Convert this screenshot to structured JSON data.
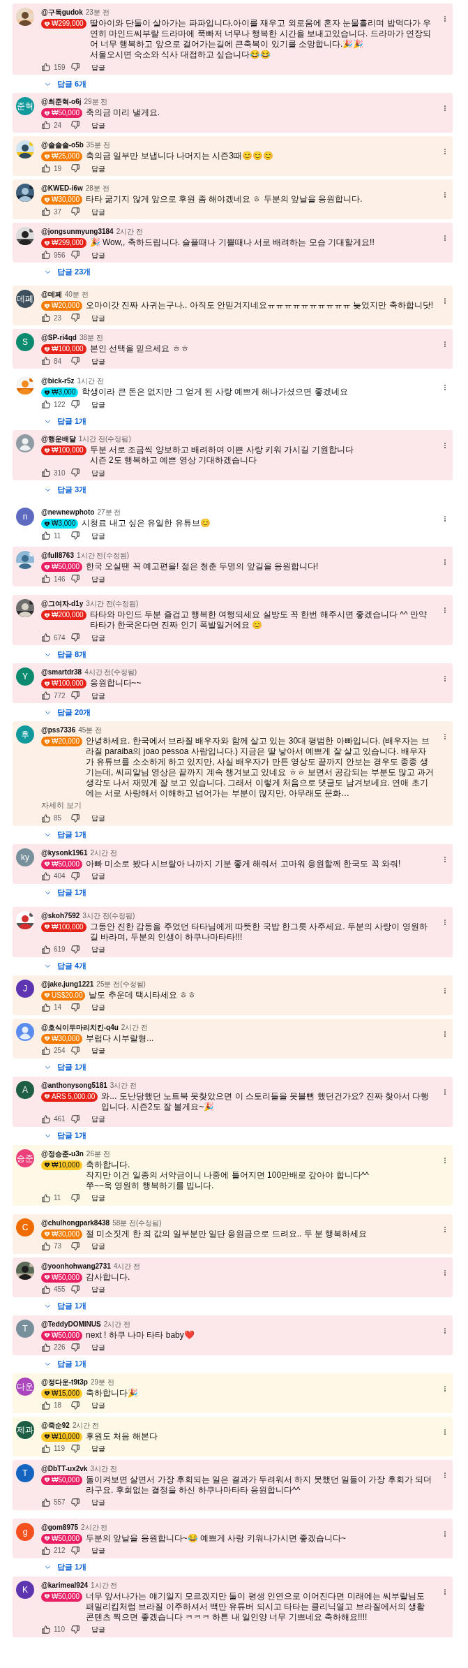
{
  "groups": [
    {
      "comments": [
        {
          "user": "@구독gudok",
          "time": "23분 전",
          "badge": {
            "amount": "₩299,000",
            "color": "#e62117"
          },
          "text": "딸아이와 단둘이 살아가는 파파입니다.아이를 재우고 외로움에 혼자 눈물흘리며 밥먹다가 우연히 마인드씨부랄 드라마에 푹빠저 너무나 행복한 시간을 보내고있습니다. 드라마가 연장되어 너무 행복하고 앞으로 걸어가는길에 큰축복이 있기를 소망합니다.🎉🎉\n서울오시면 숙소와 식사 대접하고 싶습니다😂😂",
          "likes": "159",
          "reply": "답글",
          "replies": "답글 6개"
        },
        {
          "user": "@최준혁-o6j",
          "time": "29분 전",
          "avatar": {
            "kind": "letter",
            "letter": "준혁",
            "color": "#12999b"
          },
          "badge": {
            "amount": "₩50,000",
            "color": "#e91e63"
          },
          "text": "축의금 미리 낼게요.",
          "likes": "24",
          "reply": "답글"
        },
        {
          "user": "@솔솔솔-o5b",
          "time": "35분 전",
          "badge": {
            "amount": "₩25,000",
            "color": "#f57c00"
          },
          "text": "축의금 일부만 보냅니다 나머지는 시즌3때😊😊😊",
          "likes": "19",
          "reply": "답글"
        },
        {
          "user": "@KWED-i6w",
          "time": "28분 전",
          "badge": {
            "amount": "₩30,000",
            "color": "#f57c00"
          },
          "text": "타타 굶기지 않게 앞으로 후원 좀 해야겠네요 ㅎ 두분의 앞날을 응원합니다.",
          "likes": "37",
          "reply": "답글"
        },
        {
          "user": "@jongsunmyung3184",
          "time": "2시간 전",
          "badge": {
            "amount": "₩299,000",
            "color": "#e62117"
          },
          "text": "🎉 Wow,, 축하드립니다. 슬플때나 기쁠때나 서로 배려하는 모습 기대할게요!!",
          "likes": "956",
          "reply": "답글",
          "replies": "답글 23개"
        }
      ]
    },
    {
      "comments": [
        {
          "user": "@데페",
          "time": "40분 전",
          "avatar": {
            "kind": "letter",
            "letter": "데페",
            "color": "#3d4f5c"
          },
          "badge": {
            "amount": "₩20,000",
            "color": "#f57c00"
          },
          "text": "오마이갓 진짜 사귀는구나.. 아직도 안믿겨지네요ㅠㅠㅠㅠㅠㅠㅠㅠㅠㅠ 늦었지만 축하합니닷!",
          "likes": "23",
          "reply": "답글"
        },
        {
          "user": "@SP-ri4qd",
          "time": "38분 전",
          "avatar": {
            "kind": "letter",
            "letter": "S",
            "color": "#0b8a6f"
          },
          "badge": {
            "amount": "₩100,000",
            "color": "#e62117"
          },
          "text": "본인 선택을 믿으세요 ㅎㅎ",
          "likes": "84",
          "reply": "답글"
        },
        {
          "user": "@bick-r5z",
          "time": "1시간 전",
          "badge": {
            "amount": "₩3,000",
            "color": "#00e5ff"
          },
          "text": "학생이라 큰 돈은 없지만 그 얻게 된 사랑 예쁘게 해나가셨으면 좋겠네요",
          "likes": "122",
          "reply": "답글",
          "replies": "답글 1개"
        },
        {
          "user": "@행운배달",
          "time": "1시간 전(수정됨)",
          "avatar": {
            "kind": "default",
            "color": "#8f9ba3"
          },
          "badge": {
            "amount": "₩100,000",
            "color": "#e62117"
          },
          "text": "두분 서로 조금씩 양보하고 배려하여 이쁜 사랑 키워 가시길 기원합니다\n시즌 2도 행복하고 예쁜 영상 기대하겠습니다",
          "likes": "310",
          "reply": "답글",
          "replies": "답글 3개"
        }
      ]
    },
    {
      "comments": [
        {
          "user": "@newnewphoto",
          "time": "27분 전",
          "avatar": {
            "kind": "letter",
            "letter": "n",
            "color": "#5c6bc0"
          },
          "badge": {
            "amount": "₩3,000",
            "color": "#00e5ff"
          },
          "text": "시청료 내고 싶은 유일한 유튜브😊",
          "likes": "11",
          "reply": "답글"
        },
        {
          "user": "@full8763",
          "time": "1시간 전(수정됨)",
          "badge": {
            "amount": "₩50,000",
            "color": "#e91e63"
          },
          "text": "한국 오실땐 꼭 예고편을! 젊은 청춘 두명의 앞길을 응원합니다!",
          "likes": "146",
          "reply": "답글"
        }
      ]
    },
    {
      "comments": [
        {
          "user": "@그여자-d1y",
          "time": "3시간 전(수정됨)",
          "badge": {
            "amount": "₩200,000",
            "color": "#e62117"
          },
          "text": "타타와  마인드 두분 즐겁고 행복한 여행되세요   실방도 꼭 한번 해주시면 좋겠습니다 ^^  만약 타타가 한국온다면 진짜 인기 폭발일거에요 😊",
          "likes": "674",
          "reply": "답글",
          "replies": "답글 8개"
        },
        {
          "user": "@smartdr38",
          "time": "4시간 전(수정됨)",
          "avatar": {
            "kind": "letter",
            "letter": "Y",
            "color": "#0b8a6f"
          },
          "badge": {
            "amount": "₩100,000",
            "color": "#e62117"
          },
          "text": "응원합니다~~",
          "likes": "772",
          "reply": "답글",
          "replies": "답글 20개"
        },
        {
          "user": "@pss7336",
          "time": "45분 전",
          "avatar": {
            "kind": "letter",
            "letter": "후",
            "color": "#12999b"
          },
          "badge": {
            "amount": "₩20,000",
            "color": "#f57c00"
          },
          "text": "안녕하세요. 한국에서 브라질 배우자와 함께 살고 있는 30대 평범한 아빠입니다. (배우자는 브라질 paraiba의 joao pessoa 사람입니다.) 지금은 딸 낳아서 예쁘게 잘 살고 있습니다. 배우자가 유튜브를 소소하게 하고 있지만, 사실 배우자가 만든 영상도 끝까지 안보는 경우도 종종 생기는데, 씨피알님 영상은 끝까지 계속 챙겨보고 있네요 ㅎㅎ 보면서 공감되는 부분도 많고 과거생각도 나서 재밌게 잘 보고 있습니다. 그래서 이렇게 처음으로 댓글도 남겨보네요. 연애 초기에는 서로 사랑해서 이해하고 넘어가는 부분이 많지만, 아무래도 문화…",
          "more": "자세히 보기",
          "likes": "85",
          "reply": "답글",
          "replies": "답글 1개"
        },
        {
          "user": "@kysonk1961",
          "time": "2시간 전",
          "avatar": {
            "kind": "letter",
            "letter": "ky",
            "color": "#78909c"
          },
          "badge": {
            "amount": "₩50,000",
            "color": "#e91e63"
          },
          "text": "아빠 미소로 봤다 시브랄아 나까지 기분 좋게 해줘서 고마워 응원할께 한국도 꼭 와줘!",
          "likes": "404",
          "reply": "답글",
          "replies": "답글 1개"
        }
      ]
    },
    {
      "comments": [
        {
          "user": "@skoh7592",
          "time": "3시간 전(수정됨)",
          "badge": {
            "amount": "₩100,000",
            "color": "#e62117"
          },
          "text": "그동안 진한 감동을 주었던 타타님에게 따뜻한 국밥 한그릇 사주세요. 두분의 사랑이 영원하길 바라며, 두분의 인생이 하쿠나마타타!!!",
          "likes": "619",
          "reply": "답글",
          "replies": "답글 4개"
        },
        {
          "user": "@jake.jung1221",
          "time": "25분 전(수정됨)",
          "avatar": {
            "kind": "letter",
            "letter": "J",
            "color": "#5e35b1"
          },
          "badge": {
            "amount": "US$20.00",
            "color": "#f57c00"
          },
          "text": "날도 추운데 택시타세요 ㅎㅎ",
          "likes": "14",
          "reply": "답글"
        },
        {
          "user": "@호식이두마리치킨-q4u",
          "time": "2시간 전",
          "avatar": {
            "kind": "default",
            "color": "#5b8def"
          },
          "badge": {
            "amount": "₩30,000",
            "color": "#f57c00"
          },
          "text": "부럽다 시부랄형...",
          "likes": "254",
          "reply": "답글",
          "replies": "답글 1개"
        },
        {
          "user": "@anthonysong5181",
          "time": "3시간 전",
          "avatar": {
            "kind": "letter",
            "letter": "A",
            "color": "#1e5e45"
          },
          "badge": {
            "amount": "ARS 5,000.00",
            "color": "#e62117"
          },
          "text": "와... 도난당했던 노트북 못찾았으면 이 스토리들을 못볼뻔 했던건가요? 진짜 찾아서 다행입니다. 시즌2도 잘 볼게요~🎉",
          "likes": "461",
          "reply": "답글",
          "replies": "답글 1개"
        },
        {
          "user": "@정승준-u3n",
          "time": "26분 전",
          "avatar": {
            "kind": "letter",
            "letter": "승준",
            "color": "#ec407a"
          },
          "badge": {
            "amount": "₩10,000",
            "color": "#ffca28"
          },
          "text": "축하합니다.\n작지만 이건 일종의 서약금이니 나중에 틀어지면 100만배로 갚아야 합니다^^\n쭈~~욱 영원히 행복하기를 빕니다.",
          "likes": "11",
          "reply": "답글"
        }
      ]
    },
    {
      "comments": [
        {
          "user": "@chulhongpark8438",
          "time": "58분 전(수정됨)",
          "avatar": {
            "kind": "letter",
            "letter": "C",
            "color": "#ef6c00"
          },
          "badge": {
            "amount": "₩30,000",
            "color": "#f57c00"
          },
          "text": "절 미소짓게 한 죄 값의 일부분만 일단 응원금으로 드려요.. 두 분 행복하세요",
          "likes": "73",
          "reply": "답글"
        },
        {
          "user": "@yoonhohwang2731",
          "time": "4시간 전",
          "badge": {
            "amount": "₩50,000",
            "color": "#e91e63"
          },
          "text": "감사합니다.",
          "likes": "455",
          "reply": "답글",
          "replies": "답글 1개"
        },
        {
          "user": "@TeddyDOMINUS",
          "time": "2시간 전",
          "avatar": {
            "kind": "letter",
            "letter": "T",
            "color": "#78909c"
          },
          "badge": {
            "amount": "₩50,000",
            "color": "#e91e63"
          },
          "text": "next ! 하쿠 나마 타타  baby❤️",
          "likes": "226",
          "reply": "답글",
          "replies": "답글 1개"
        },
        {
          "user": "@정다운-t9t3p",
          "time": "29분 전",
          "avatar": {
            "kind": "letter",
            "letter": "다운",
            "color": "#ab47bc"
          },
          "badge": {
            "amount": "₩15,000",
            "color": "#ffca28"
          },
          "text": "축하합니다🎉",
          "likes": "18",
          "reply": "답글"
        },
        {
          "user": "@죽순92",
          "time": "2시간 전",
          "avatar": {
            "kind": "letter",
            "letter": "제과",
            "color": "#1b5e45"
          },
          "badge": {
            "amount": "₩10,000",
            "color": "#ffca28"
          },
          "text": "후원도 처음 해본다",
          "likes": "119",
          "reply": "답글"
        },
        {
          "user": "@DbTT-ux2vk",
          "time": "3시간 전",
          "avatar": {
            "kind": "letter",
            "letter": "T",
            "color": "#1565c0"
          },
          "badge": {
            "amount": "₩50,000",
            "color": "#e91e63"
          },
          "text": "돌이켜보면 살면서 가장 후회되는 일은 결과가 두려워서 하지 못했던 일들이 가장 후회가 되더라구요. 후회없는 결정을 하신 하쿠나마타타 응원합니다^^",
          "likes": "557",
          "reply": "답글"
        }
      ]
    },
    {
      "comments": [
        {
          "user": "@gom8975",
          "time": "2시간 전",
          "avatar": {
            "kind": "letter",
            "letter": "g",
            "color": "#f4511e"
          },
          "badge": {
            "amount": "₩50,000",
            "color": "#e91e63"
          },
          "text": "두분의 앞날을 응원합니다~😂 예쁘게 사랑 키워나가시면 좋겠습니다~",
          "likes": "212",
          "reply": "답글",
          "replies": "답글 1개"
        },
        {
          "user": "@karimeal924",
          "time": "1시간 전",
          "avatar": {
            "kind": "letter",
            "letter": "K",
            "color": "#5e35b1"
          },
          "badge": {
            "amount": "₩50,000",
            "color": "#e91e63"
          },
          "text": "너무 앞서나가는 얘기일지 모르겠지만 둘이 평생 인연으로 이어진다면 미래에는 씨부랄님도 패밀리킴처럼 브라질 이주하셔서 백만 유튜버 되시고 타타는 클리닉열고 브라질에서의 생활 콘텐츠 찍으면 좋겠습니다 ㅋㅋㅋ  하튼 내 일인양 너무 기쁘네요 축하해요!!!!",
          "likes": "110",
          "reply": "답글"
        }
      ]
    }
  ]
}
